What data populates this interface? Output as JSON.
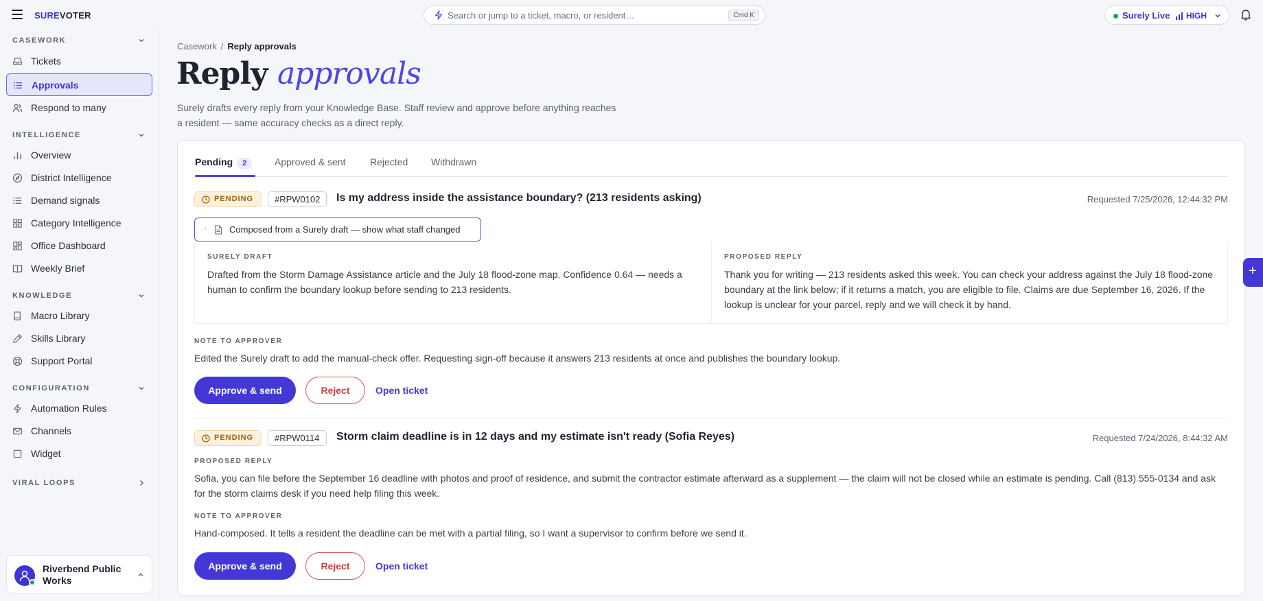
{
  "app": {
    "logo_part1": "SURE",
    "logo_part2": "VOTER"
  },
  "search": {
    "placeholder": "Search or jump to a ticket, macro, or resident…",
    "shortcut": "Cmd K"
  },
  "status": {
    "label": "Surely Live",
    "level": "HIGH",
    "dot_color": "#18a957"
  },
  "sidebar": {
    "sections": [
      {
        "label": "CASEWORK",
        "items": [
          {
            "label": "Tickets",
            "icon": "inbox-icon"
          },
          {
            "label": "Approvals",
            "icon": "list-icon",
            "active": true
          },
          {
            "label": "Respond to many",
            "icon": "users-icon"
          }
        ]
      },
      {
        "label": "INTELLIGENCE",
        "items": [
          {
            "label": "Overview",
            "icon": "bar-chart-icon"
          },
          {
            "label": "District Intelligence",
            "icon": "compass-icon"
          },
          {
            "label": "Demand signals",
            "icon": "list-icon"
          },
          {
            "label": "Category Intelligence",
            "icon": "grid-icon"
          },
          {
            "label": "Office Dashboard",
            "icon": "dashboard-icon"
          },
          {
            "label": "Weekly Brief",
            "icon": "book-open-icon"
          }
        ]
      },
      {
        "label": "KNOWLEDGE",
        "items": [
          {
            "label": "Macro Library",
            "icon": "book-icon"
          },
          {
            "label": "Skills Library",
            "icon": "pen-icon"
          },
          {
            "label": "Support Portal",
            "icon": "lifebuoy-icon"
          }
        ]
      },
      {
        "label": "CONFIGURATION",
        "items": [
          {
            "label": "Automation Rules",
            "icon": "bolt-icon"
          },
          {
            "label": "Channels",
            "icon": "mail-icon"
          },
          {
            "label": "Widget",
            "icon": "square-icon"
          }
        ]
      },
      {
        "label": "VIRAL LOOPS",
        "items": []
      }
    ],
    "org_name": "Riverbend Public Works"
  },
  "breadcrumb": {
    "parent": "Casework",
    "separator": "/",
    "current": "Reply approvals"
  },
  "page": {
    "title_plain": "Reply",
    "title_accent": "approvals",
    "subtitle": "Surely drafts every reply from your Knowledge Base. Staff review and approve before anything reaches a resident — same accuracy checks as a direct reply."
  },
  "tabs": [
    {
      "label": "Pending",
      "count": "2",
      "active": true
    },
    {
      "label": "Approved & sent"
    },
    {
      "label": "Rejected"
    },
    {
      "label": "Withdrawn"
    }
  ],
  "approvals": [
    {
      "status": "PENDING",
      "id": "#RPW0102",
      "title": "Is my address inside the assistance boundary? (213 residents asking)",
      "requested": "Requested 7/25/2026, 12:44:32 PM",
      "compose_toggle": "Composed from a Surely draft — show what staff changed",
      "bullet": "·",
      "draft_label": "SURELY DRAFT",
      "draft": "Drafted from the Storm Damage Assistance article and the July 18 flood-zone map. Confidence 0.64 — needs a human to confirm the boundary lookup before sending to 213 residents.",
      "reply_label": "PROPOSED REPLY",
      "reply": "Thank you for writing — 213 residents asked this week. You can check your address against the July 18 flood-zone boundary at the link below; if it returns a match, you are eligible to file. Claims are due September 16, 2026. If the lookup is unclear for your parcel, reply and we will check it by hand.",
      "note_label": "NOTE TO APPROVER",
      "note": "Edited the Surely draft to add the manual-check offer. Requesting sign-off because it answers 213 residents at once and publishes the boundary lookup.",
      "approve": "Approve & send",
      "reject": "Reject",
      "open": "Open ticket"
    },
    {
      "status": "PENDING",
      "id": "#RPW0114",
      "title": "Storm claim deadline is in 12 days and my estimate isn't ready (Sofia Reyes)",
      "requested": "Requested 7/24/2026, 8:44:32 AM",
      "reply_label": "PROPOSED REPLY",
      "reply": "Sofia, you can file before the September 16 deadline with photos and proof of residence, and submit the contractor estimate afterward as a supplement — the claim will not be closed while an estimate is pending. Call (813) 555-0134 and ask for the storm claims desk if you need help filing this week.",
      "note_label": "NOTE TO APPROVER",
      "note": "Hand-composed. It tells a resident the deadline can be met with a partial filing, so I want a supervisor to confirm before we send it.",
      "approve": "Approve & send",
      "reject": "Reject",
      "open": "Open ticket"
    }
  ],
  "fab": {
    "label": "+"
  },
  "colors": {
    "accent": "#4338d6",
    "pending_bg": "#fdf1dc",
    "pending_text": "#a0600b",
    "reject": "#c8423d"
  }
}
